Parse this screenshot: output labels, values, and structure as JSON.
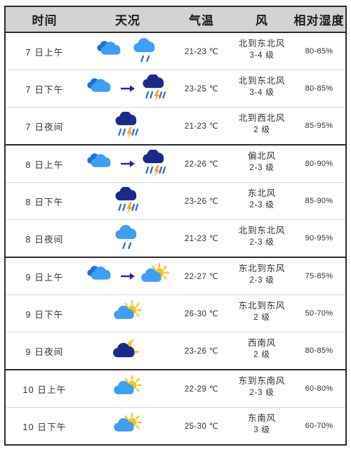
{
  "table": {
    "headers": {
      "time": "时间",
      "sky": "天况",
      "temp": "气温",
      "wind": "风",
      "humidity": "相对湿度"
    },
    "colors": {
      "header_bg": "#d3d3d3",
      "border_strong": "#2b2b2b",
      "border_light": "#d8d8d8",
      "cloud_light": "#3d9ff5",
      "cloud_mid": "#1f6fe0",
      "cloud_dark": "#1b2a8a",
      "sun_yellow": "#f5c518",
      "bolt_orange": "#f5a623",
      "rain_blue": "#2f6fd0",
      "arrow_purple": "#2a20a8",
      "text": "#2e2e2e"
    },
    "rows": [
      {
        "time": "7 日上午",
        "icons": [
          "cloudy",
          "rain-light"
        ],
        "arrow": false,
        "temp": "21-23 ℃",
        "wind_dir": "北到东北风",
        "wind_force": "3-4 级",
        "humidity": "80-85%",
        "day_start": true
      },
      {
        "time": "7 日下午",
        "icons": [
          "cloudy",
          "thunderstorm"
        ],
        "arrow": true,
        "temp": "23-25 ℃",
        "wind_dir": "北到东北风",
        "wind_force": "3-4 级",
        "humidity": "80-85%",
        "day_start": false
      },
      {
        "time": "7 日夜间",
        "icons": [
          "thunderstorm"
        ],
        "arrow": false,
        "temp": "21-23 ℃",
        "wind_dir": "北到西北风",
        "wind_force": "2 级",
        "humidity": "85-95%",
        "day_start": false
      },
      {
        "time": "8 日上午",
        "icons": [
          "cloudy",
          "thunderstorm"
        ],
        "arrow": true,
        "temp": "22-26 ℃",
        "wind_dir": "偏北风",
        "wind_force": "2-3 级",
        "humidity": "80-90%",
        "day_start": true
      },
      {
        "time": "8 日下午",
        "icons": [
          "thunderstorm"
        ],
        "arrow": false,
        "temp": "23-26 ℃",
        "wind_dir": "东北风",
        "wind_force": "2-3 级",
        "humidity": "85-90%",
        "day_start": false
      },
      {
        "time": "8 日夜间",
        "icons": [
          "rain-light"
        ],
        "arrow": false,
        "temp": "21-23 ℃",
        "wind_dir": "北到东北风",
        "wind_force": "2-3 级",
        "humidity": "90-95%",
        "day_start": false
      },
      {
        "time": "9 日上午",
        "icons": [
          "cloudy",
          "sun-cloud"
        ],
        "arrow": true,
        "temp": "22-27 ℃",
        "wind_dir": "东北到东风",
        "wind_force": "2-3 级",
        "humidity": "75-85%",
        "day_start": true
      },
      {
        "time": "9 日下午",
        "icons": [
          "sun-cloud"
        ],
        "arrow": false,
        "temp": "26-30 ℃",
        "wind_dir": "东北到东风",
        "wind_force": "2 级",
        "humidity": "50-70%",
        "day_start": false
      },
      {
        "time": "9 日夜间",
        "icons": [
          "moon-cloud"
        ],
        "arrow": false,
        "temp": "23-26 ℃",
        "wind_dir": "西南风",
        "wind_force": "2 级",
        "humidity": "80-85%",
        "day_start": false
      },
      {
        "time": "10 日上午",
        "icons": [
          "sun-cloud"
        ],
        "arrow": false,
        "temp": "22-29 ℃",
        "wind_dir": "东到东南风",
        "wind_force": "2-3 级",
        "humidity": "60-80%",
        "day_start": true
      },
      {
        "time": "10 日下午",
        "icons": [
          "sun-cloud"
        ],
        "arrow": false,
        "temp": "25-30 ℃",
        "wind_dir": "东南风",
        "wind_force": "3 级",
        "humidity": "60-70%",
        "day_start": false
      }
    ]
  }
}
